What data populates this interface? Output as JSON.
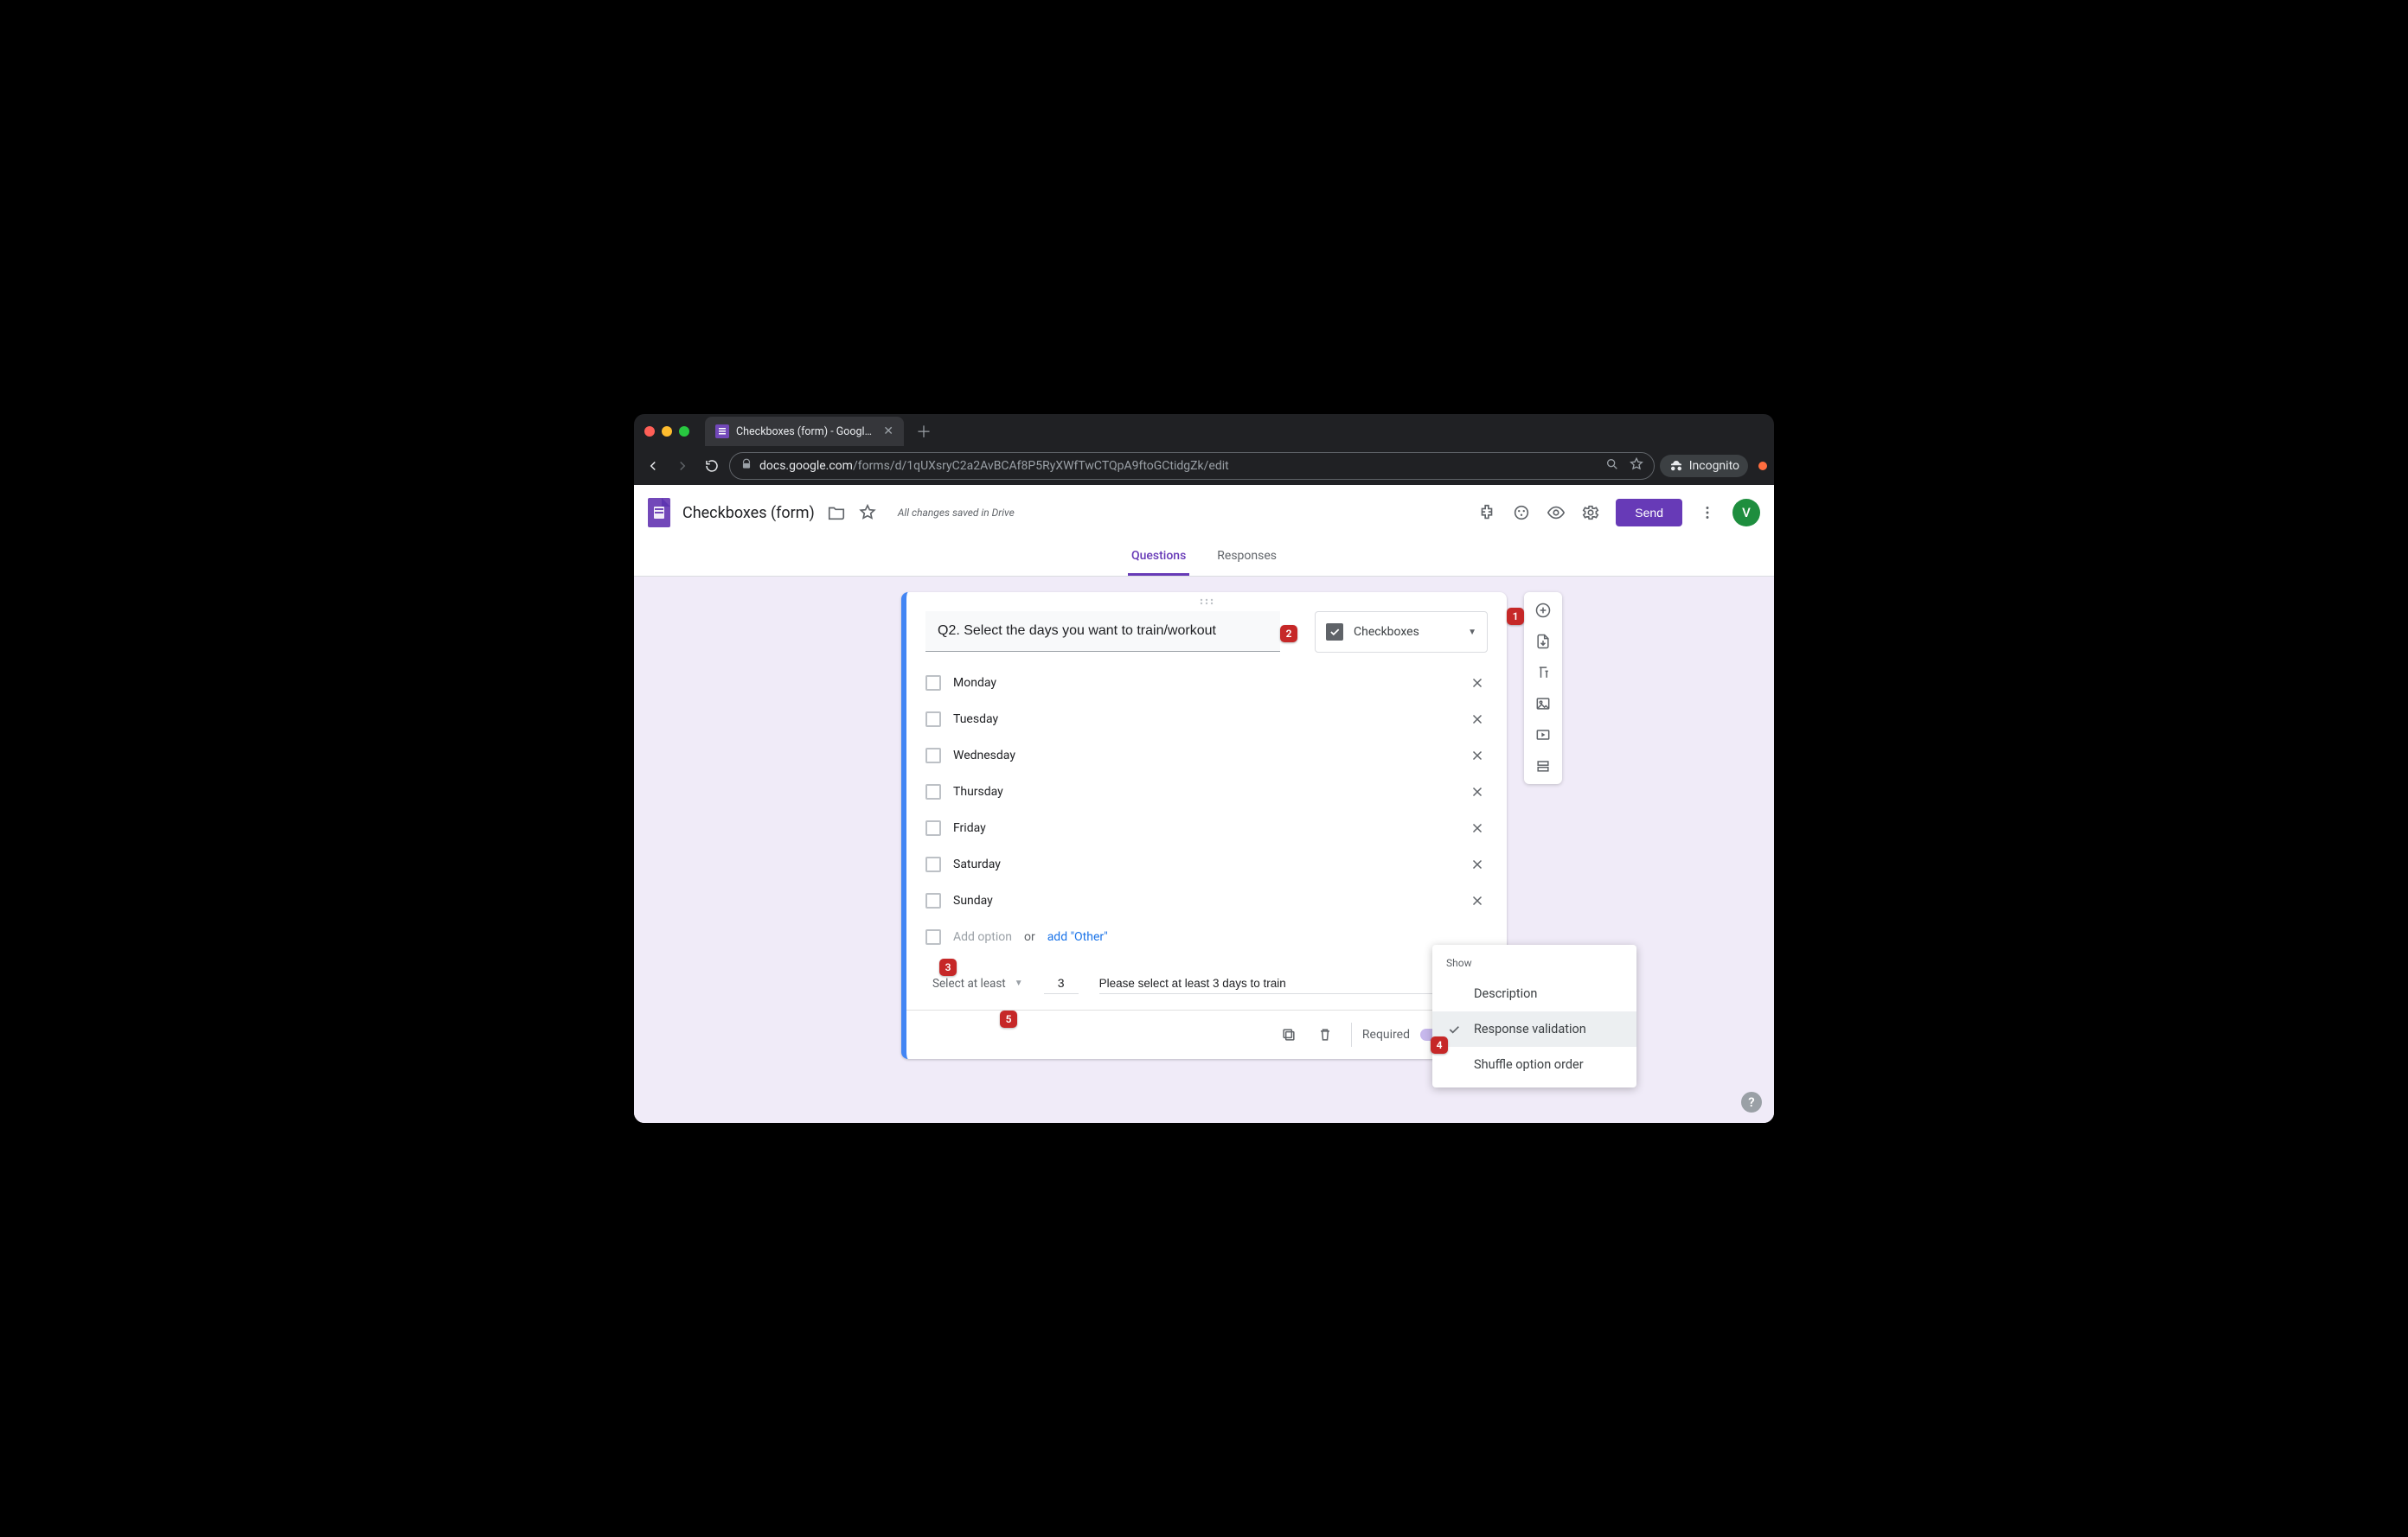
{
  "browser": {
    "tab_title": "Checkboxes (form) - Google Fo",
    "url_host": "docs.google.com",
    "url_path": "/forms/d/1qUXsryC2a2AvBCAf8P5RyXWfTwCTQpA9ftoGCtidgZk/edit",
    "incognito_label": "Incognito"
  },
  "header": {
    "doc_title": "Checkboxes (form)",
    "saved_text": "All changes saved in Drive",
    "send_label": "Send",
    "avatar_initial": "V"
  },
  "tabs": {
    "questions": "Questions",
    "responses": "Responses",
    "active": "questions"
  },
  "question": {
    "text": "Q2. Select the days you want to train/workout",
    "type_label": "Checkboxes",
    "options": [
      "Monday",
      "Tuesday",
      "Wednesday",
      "Thursday",
      "Friday",
      "Saturday",
      "Sunday"
    ],
    "add_option_placeholder": "Add option",
    "add_or": "or",
    "add_other": "add \"Other\""
  },
  "validation": {
    "rule_label": "Select at least",
    "number": "3",
    "error_message": "Please select at least 3 days to train"
  },
  "footer": {
    "required_label": "Required",
    "required_on": true
  },
  "context_menu": {
    "section_label": "Show",
    "items": [
      {
        "label": "Description",
        "selected": false
      },
      {
        "label": "Response validation",
        "selected": true
      },
      {
        "label": "Shuffle option order",
        "selected": false
      }
    ]
  },
  "side_toolbar": {
    "items": [
      "add-question",
      "import-questions",
      "add-title",
      "add-image",
      "add-video",
      "add-section"
    ]
  },
  "annotations": {
    "a1": "1",
    "a2": "2",
    "a3": "3",
    "a4": "4",
    "a5": "5"
  }
}
